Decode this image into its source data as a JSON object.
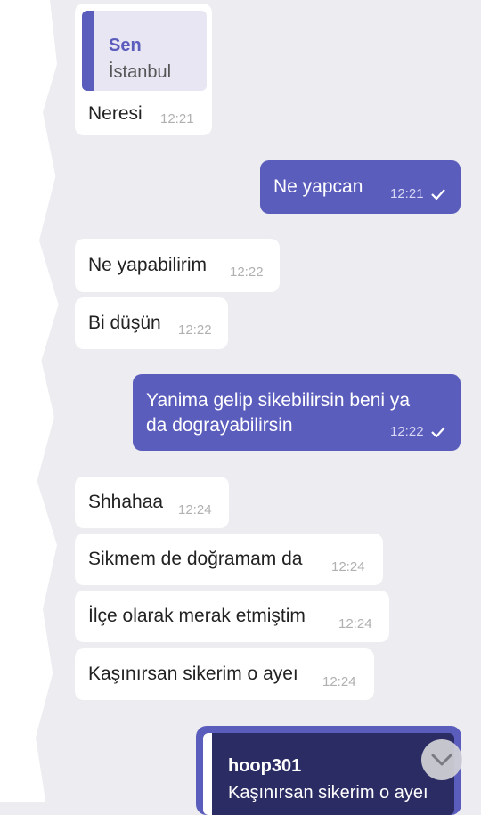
{
  "messages": [
    {
      "id": "m1",
      "side": "in",
      "quote": {
        "name": "Sen",
        "text": "İstanbul"
      },
      "text": "Neresi",
      "time": "12:21"
    },
    {
      "id": "m2",
      "side": "out",
      "text": "Ne yapcan",
      "time": "12:21"
    },
    {
      "id": "m3",
      "side": "in",
      "text": "Ne yapabilirim",
      "time": "12:22"
    },
    {
      "id": "m4",
      "side": "in",
      "text": "Bi düşün",
      "time": "12:22"
    },
    {
      "id": "m5",
      "side": "out",
      "line1": "Yanima gelip sikebilirsin beni ya",
      "line2": "da dograyabilirsin",
      "time": "12:22"
    },
    {
      "id": "m6",
      "side": "in",
      "text": "Shhahaa",
      "time": "12:24"
    },
    {
      "id": "m7",
      "side": "in",
      "text": "Sikmem de doğramam da",
      "time": "12:24"
    },
    {
      "id": "m8",
      "side": "in",
      "text": "İlçe olarak merak etmiştim",
      "time": "12:24"
    },
    {
      "id": "m9",
      "side": "in",
      "text": "Kaşınırsan sikerim o ayeı",
      "time": "12:24"
    }
  ],
  "reply": {
    "name": "hoop301",
    "text": "Kaşınırsan sikerim o ayeı"
  },
  "icons": {
    "read": "check-icon",
    "scroll": "chevron-down-icon"
  },
  "colors": {
    "outgoing": "#5b5dbd",
    "incoming": "#ffffff",
    "background": "#ececf1"
  }
}
